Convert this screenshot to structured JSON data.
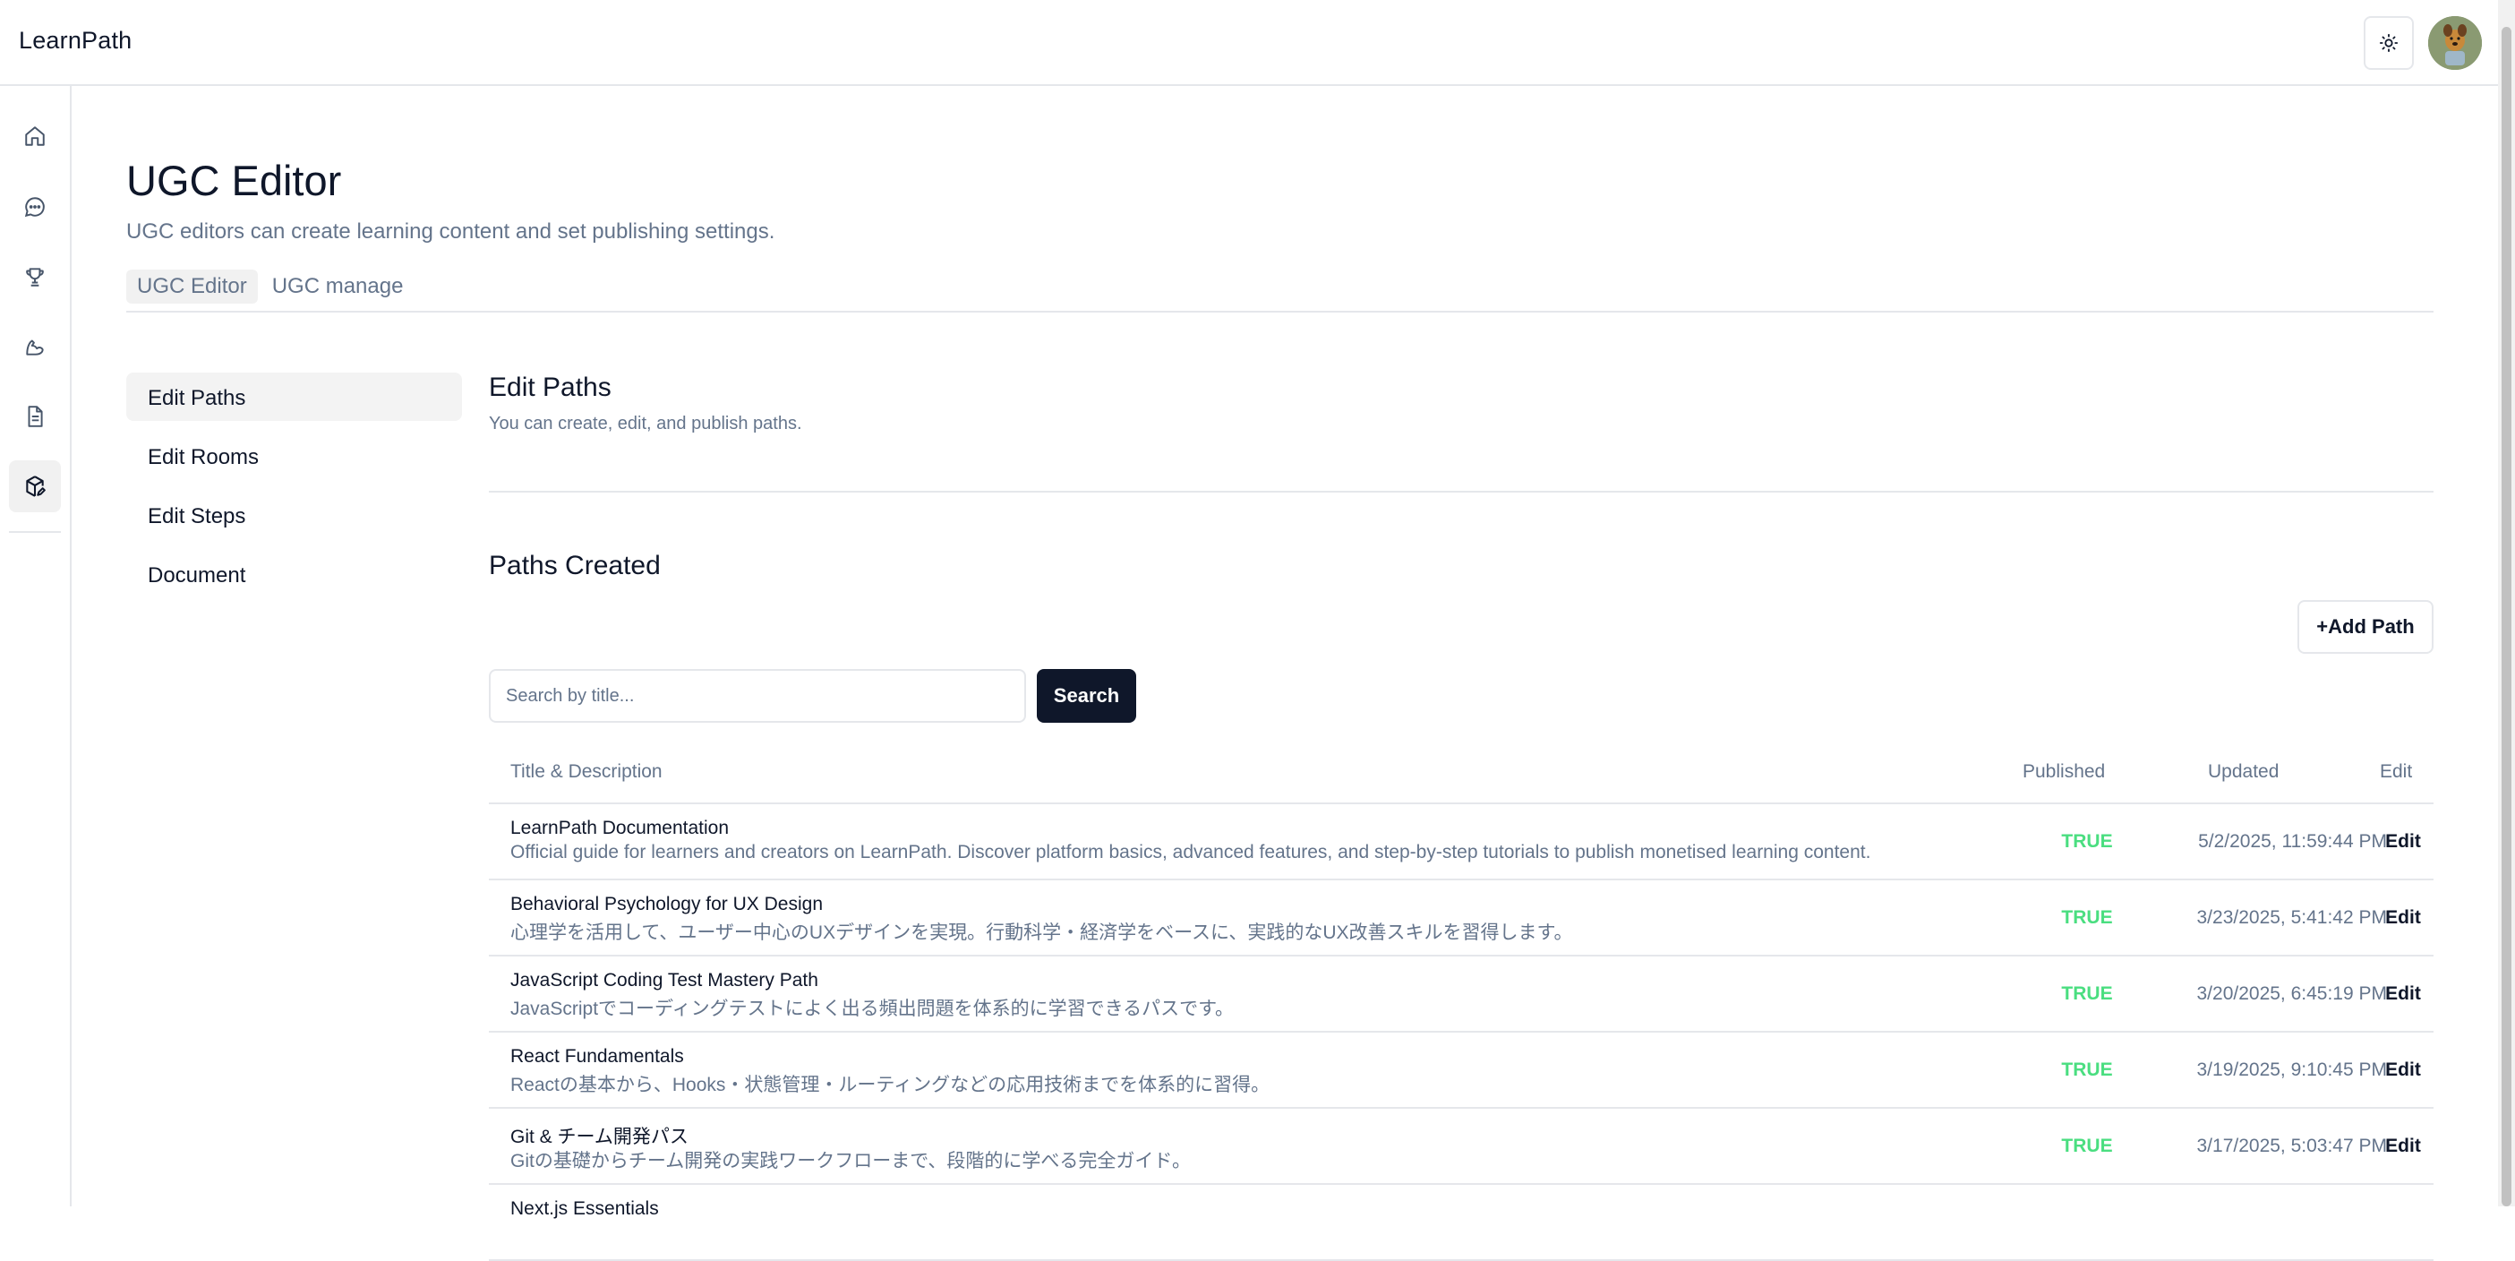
{
  "app": {
    "brand": "LearnPath"
  },
  "colors": {
    "primary": "#0f172a",
    "muted": "#64748b",
    "published": "#4ade80",
    "border": "#e5e7eb"
  },
  "header": {
    "theme_icon": "sun-icon",
    "avatar_icon": "user-avatar"
  },
  "sidebar": {
    "icons": [
      "home-icon",
      "chat-icon",
      "trophy-icon",
      "muscle-icon",
      "document-icon",
      "package-edit-icon"
    ],
    "active": "package-edit-icon"
  },
  "page": {
    "title": "UGC Editor",
    "subtitle": "UGC editors can create learning content and set publishing settings.",
    "tabs": [
      {
        "label": "UGC Editor",
        "active": true
      },
      {
        "label": "UGC manage",
        "active": false
      }
    ]
  },
  "menu": {
    "items": [
      {
        "label": "Edit Paths",
        "active": true
      },
      {
        "label": "Edit Rooms",
        "active": false
      },
      {
        "label": "Edit Steps",
        "active": false
      },
      {
        "label": "Document",
        "active": false
      }
    ]
  },
  "section": {
    "title": "Edit Paths",
    "subtitle": "You can create, edit, and publish paths."
  },
  "paths": {
    "title": "Paths Created",
    "add_label": "+Add Path",
    "search_placeholder": "Search by title...",
    "search_label": "Search",
    "columns": {
      "title": "Title & Description",
      "published": "Published",
      "updated": "Updated",
      "edit": "Edit"
    },
    "rows": [
      {
        "title": "LearnPath Documentation",
        "description": "Official guide for learners and creators on LearnPath. Discover platform basics, advanced features, and step-by-step tutorials to publish monetised learning content.",
        "published": "TRUE",
        "updated": "5/2/2025, 11:59:44 PM",
        "edit": "Edit"
      },
      {
        "title": "Behavioral Psychology for UX Design",
        "description": "心理学を活用して、ユーザー中心のUXデザインを実現。行動科学・経済学をベースに、実践的なUX改善スキルを習得します。",
        "published": "TRUE",
        "updated": "3/23/2025, 5:41:42 PM",
        "edit": "Edit"
      },
      {
        "title": "JavaScript Coding Test Mastery Path",
        "description": "JavaScriptでコーディングテストによく出る頻出問題を体系的に学習できるパスです。",
        "published": "TRUE",
        "updated": "3/20/2025, 6:45:19 PM",
        "edit": "Edit"
      },
      {
        "title": "React Fundamentals",
        "description": "Reactの基本から、Hooks・状態管理・ルーティングなどの応用技術までを体系的に習得。",
        "published": "TRUE",
        "updated": "3/19/2025, 9:10:45 PM",
        "edit": "Edit"
      },
      {
        "title": "Git & チーム開発パス",
        "description": "Gitの基礎からチーム開発の実践ワークフローまで、段階的に学べる完全ガイド。",
        "published": "TRUE",
        "updated": "3/17/2025, 5:03:47 PM",
        "edit": "Edit"
      },
      {
        "title": "Next.js Essentials",
        "description": "",
        "published": "",
        "updated": "",
        "edit": ""
      }
    ]
  }
}
